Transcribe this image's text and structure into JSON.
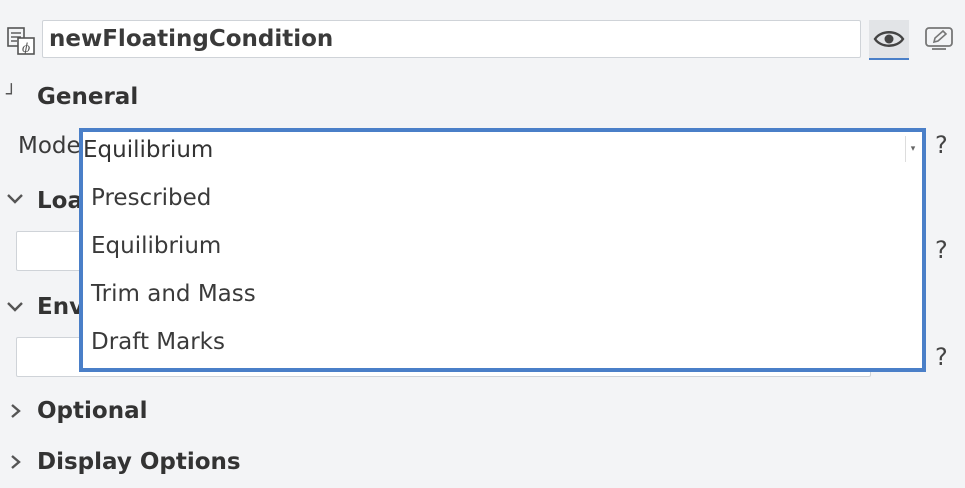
{
  "header": {
    "name_value": "newFloatingCondition",
    "visibility_icon": "eye-icon",
    "edit_icon": "edit-icon"
  },
  "sections": {
    "general": {
      "label": "General",
      "toggle": "┘"
    },
    "loading": {
      "label": "Loa"
    },
    "environment": {
      "label": "Env"
    },
    "optional": {
      "label": "Optional"
    },
    "display_options": {
      "label": "Display Options"
    }
  },
  "mode": {
    "label": "Mode",
    "selected": "Equilibrium",
    "options": [
      "Prescribed",
      "Equilibrium",
      "Trim and Mass",
      "Draft Marks"
    ]
  },
  "help": "?",
  "colors": {
    "accent": "#4a7fc8",
    "background": "#f3f4f6"
  }
}
